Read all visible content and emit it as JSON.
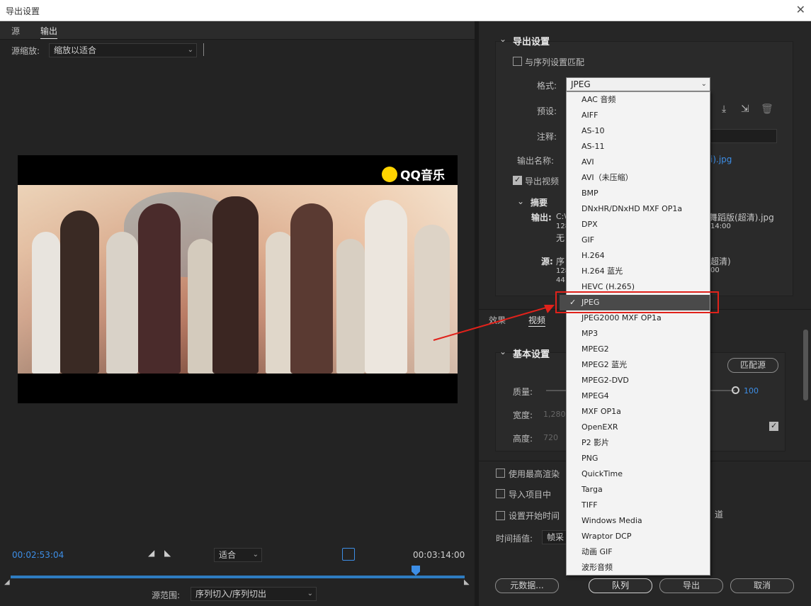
{
  "window": {
    "title": "导出设置",
    "close": "✕"
  },
  "left_panel": {
    "tabs": [
      "源",
      "输出"
    ],
    "source_scale_label": "源缩放:",
    "source_scale_value": "缩放以适合",
    "logo_text": "QQ音乐",
    "timecode_in": "00:02:53:04",
    "timecode_out": "00:03:14:00",
    "fit_value": "适合",
    "source_range_label": "源范围:",
    "source_range_value": "序列切入/序列切出"
  },
  "export_settings": {
    "title": "导出设置",
    "match_sequence_label": "与序列设置匹配",
    "format_label": "格式:",
    "format_value": "JPEG",
    "preset_label": "预设:",
    "comment_label": "注释:",
    "output_name_label": "输出名称:",
    "output_name_value": "i).jpg",
    "export_video_label": "导出视频",
    "summary_title": "摘要",
    "output_label": "输出:",
    "output_lines": [
      "C:\\",
      "128",
      "无"
    ],
    "output_right": [
      "舞蹈版(超清).jpg",
      "14:00"
    ],
    "source_label": "源:",
    "source_lines": [
      "序",
      "128",
      "441"
    ],
    "source_right": [
      "超清)",
      "00"
    ]
  },
  "bottom_tabs": [
    "效果",
    "视频"
  ],
  "basic_settings": {
    "title": "基本设置",
    "match_source_button": "匹配源",
    "quality_label": "质量:",
    "quality_value": "100",
    "width_label": "宽度:",
    "width_value": "1,280",
    "height_label": "高度:",
    "height_value": "720"
  },
  "options": {
    "max_render_label": "使用最高渲染",
    "import_project_label": "导入项目中",
    "set_start_time_label": "设置开始时间",
    "alpha_suffix": "道",
    "time_interp_label": "时间插值:",
    "time_interp_value": "帧采"
  },
  "buttons": {
    "metadata": "元数据...",
    "queue": "队列",
    "export": "导出",
    "cancel": "取消"
  },
  "format_dropdown": {
    "items": [
      "AAC 音频",
      "AIFF",
      "AS-10",
      "AS-11",
      "AVI",
      "AVI（未压缩）",
      "BMP",
      "DNxHR/DNxHD MXF OP1a",
      "DPX",
      "GIF",
      "H.264",
      "H.264 蓝光",
      "HEVC (H.265)",
      "JPEG",
      "JPEG2000 MXF OP1a",
      "MP3",
      "MPEG2",
      "MPEG2 蓝光",
      "MPEG2-DVD",
      "MPEG4",
      "MXF OP1a",
      "OpenEXR",
      "P2 影片",
      "PNG",
      "QuickTime",
      "Targa",
      "TIFF",
      "Windows Media",
      "Wraptor DCP",
      "动画 GIF",
      "波形音频"
    ],
    "selected": "JPEG"
  },
  "colors": {
    "accent": "#3d8ee6",
    "highlight": "#e0221b",
    "bg": "#232323"
  }
}
